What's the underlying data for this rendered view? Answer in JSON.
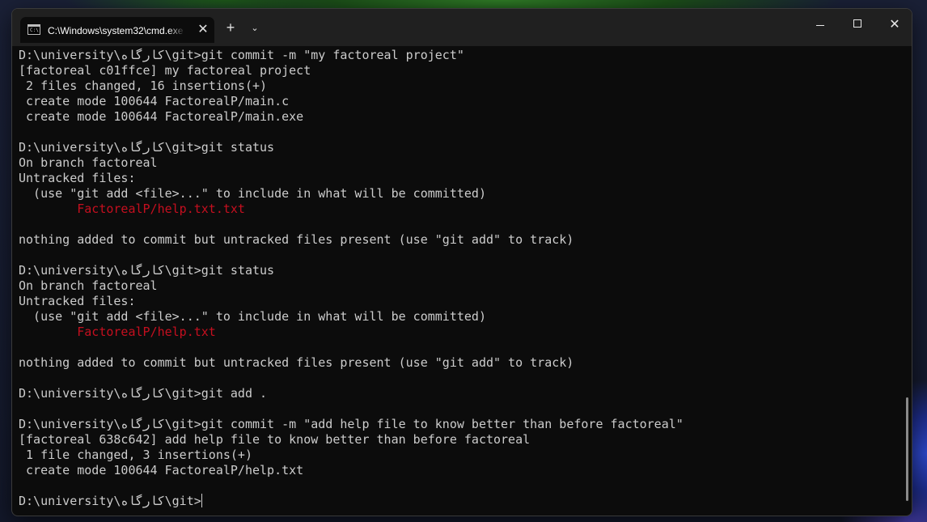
{
  "window": {
    "tab_title": "C:\\Windows\\system32\\cmd.exe",
    "tab_icon": "cmd-icon",
    "close_tab_glyph": "✕",
    "new_tab_glyph": "+",
    "dropdown_glyph": "⌄",
    "minimize": "minimize-icon",
    "maximize": "maximize-icon",
    "close_glyph": "✕"
  },
  "terminal": {
    "lines": [
      {
        "text": "D:\\university\\کارگاه\\git>git commit -m \"my factoreal project\"",
        "color": "default"
      },
      {
        "text": "[factoreal c01ffce] my factoreal project",
        "color": "default"
      },
      {
        "text": " 2 files changed, 16 insertions(+)",
        "color": "default"
      },
      {
        "text": " create mode 100644 FactorealP/main.c",
        "color": "default"
      },
      {
        "text": " create mode 100644 FactorealP/main.exe",
        "color": "default"
      },
      {
        "text": "",
        "color": "default"
      },
      {
        "text": "D:\\university\\کارگاه\\git>git status",
        "color": "default"
      },
      {
        "text": "On branch factoreal",
        "color": "default"
      },
      {
        "text": "Untracked files:",
        "color": "default"
      },
      {
        "text": "  (use \"git add <file>...\" to include in what will be committed)",
        "color": "default"
      },
      {
        "text": "        FactorealP/help.txt.txt",
        "color": "red"
      },
      {
        "text": "",
        "color": "default"
      },
      {
        "text": "nothing added to commit but untracked files present (use \"git add\" to track)",
        "color": "default"
      },
      {
        "text": "",
        "color": "default"
      },
      {
        "text": "D:\\university\\کارگاه\\git>git status",
        "color": "default"
      },
      {
        "text": "On branch factoreal",
        "color": "default"
      },
      {
        "text": "Untracked files:",
        "color": "default"
      },
      {
        "text": "  (use \"git add <file>...\" to include in what will be committed)",
        "color": "default"
      },
      {
        "text": "        FactorealP/help.txt",
        "color": "red"
      },
      {
        "text": "",
        "color": "default"
      },
      {
        "text": "nothing added to commit but untracked files present (use \"git add\" to track)",
        "color": "default"
      },
      {
        "text": "",
        "color": "default"
      },
      {
        "text": "D:\\university\\کارگاه\\git>git add .",
        "color": "default"
      },
      {
        "text": "",
        "color": "default"
      },
      {
        "text": "D:\\university\\کارگاه\\git>git commit -m \"add help file to know better than before factoreal\"",
        "color": "default"
      },
      {
        "text": "[factoreal 638c642] add help file to know better than before factoreal",
        "color": "default"
      },
      {
        "text": " 1 file changed, 3 insertions(+)",
        "color": "default"
      },
      {
        "text": " create mode 100644 FactorealP/help.txt",
        "color": "default"
      },
      {
        "text": "",
        "color": "default"
      }
    ],
    "prompt": "D:\\university\\کارگاه\\git>",
    "colors": {
      "default": "#cccccc",
      "red": "#c50f1f",
      "background": "#0c0c0c"
    }
  }
}
